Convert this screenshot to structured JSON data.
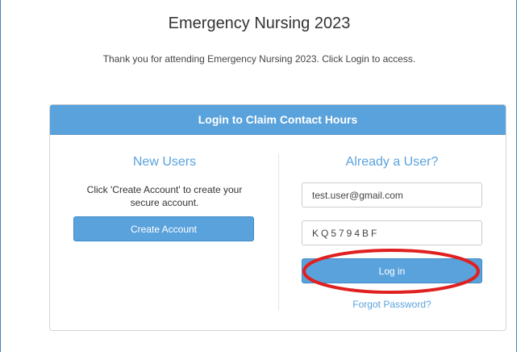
{
  "page": {
    "title": "Emergency Nursing 2023",
    "subtitle": "Thank you for attending Emergency Nursing 2023. Click Login to access."
  },
  "login_panel": {
    "header": "Login to Claim Contact Hours",
    "new_users": {
      "heading": "New Users",
      "instructions": "Click 'Create Account' to create your secure account.",
      "create_button_label": "Create Account"
    },
    "existing_users": {
      "heading": "Already a User?",
      "email_value": "test.user@gmail.com",
      "password_value": "KQ5794BF",
      "login_button_label": "Log in",
      "forgot_link_label": "Forgot Password?"
    }
  },
  "colors": {
    "accent": "#5aa2dc",
    "annotation": "#e02020"
  }
}
